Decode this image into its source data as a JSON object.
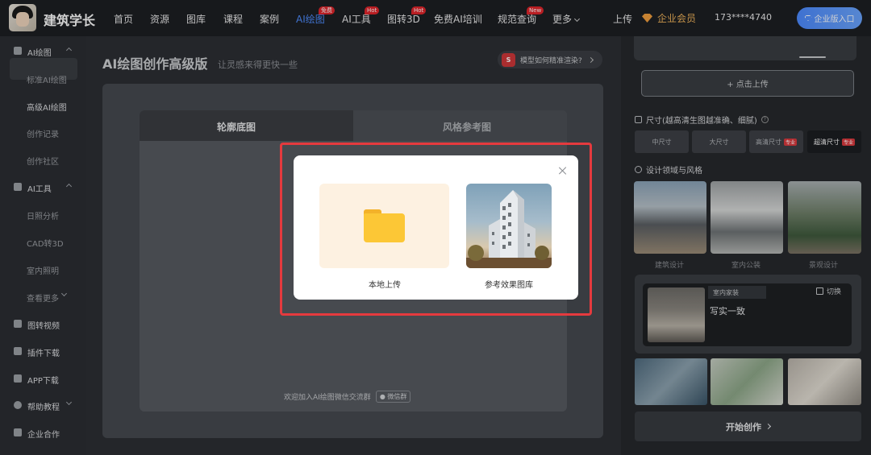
{
  "brand": {
    "name": "建筑学长"
  },
  "nav": {
    "items": [
      {
        "label": "首页"
      },
      {
        "label": "资源"
      },
      {
        "label": "图库"
      },
      {
        "label": "课程"
      },
      {
        "label": "案例"
      },
      {
        "label": "AI绘图",
        "badge": "免费",
        "active": true
      },
      {
        "label": "AI工具",
        "badge": "Hot"
      },
      {
        "label": "图转3D",
        "badge": "Hot"
      },
      {
        "label": "免费AI培训"
      },
      {
        "label": "规范查询",
        "badge": "New"
      },
      {
        "label": "更多"
      }
    ],
    "upload": "上传",
    "vip": "企业会员",
    "phone": "173****4740",
    "enterprise": "企业版入口",
    "accent_color": "#4f8dff"
  },
  "sidebar": {
    "items": [
      {
        "label": "AI绘图",
        "type": "group",
        "icon": "palette-icon"
      },
      {
        "label": "标准AI绘图",
        "type": "sub"
      },
      {
        "label": "高级AI绘图",
        "type": "sub",
        "active": true
      },
      {
        "label": "创作记录",
        "type": "sub"
      },
      {
        "label": "创作社区",
        "type": "sub"
      },
      {
        "label": "AI工具",
        "type": "group",
        "icon": "toolbox-icon"
      },
      {
        "label": "日照分析",
        "type": "sub"
      },
      {
        "label": "CAD转3D",
        "type": "sub"
      },
      {
        "label": "室内照明",
        "type": "sub"
      },
      {
        "label": "查看更多",
        "type": "sub"
      },
      {
        "label": "图转视频",
        "type": "group",
        "icon": "video-icon"
      },
      {
        "label": "插件下载",
        "type": "group",
        "icon": "puzzle-icon"
      },
      {
        "label": "APP下载",
        "type": "group",
        "icon": "download-icon"
      },
      {
        "label": "帮助教程",
        "type": "group",
        "icon": "help-icon"
      },
      {
        "label": "企业合作",
        "type": "group",
        "icon": "building-icon"
      }
    ]
  },
  "main": {
    "title": "AI绘图创作高级版",
    "subtitle": "让灵感来得更快一些",
    "hint": "模型如何精准渲染?",
    "tabs": [
      {
        "label": "轮廓底图"
      },
      {
        "label": "风格参考图"
      }
    ],
    "join_text": "欢迎加入AI绘图微信交流群",
    "join_tag": "微信群"
  },
  "modal": {
    "local_upload": "本地上传",
    "reference_gallery": "参考效果图库"
  },
  "right": {
    "upload_btn": "+ 点击上传",
    "size_title": "尺寸(越高清生图越准确、细腻)",
    "sizes": [
      {
        "label": "中尺寸"
      },
      {
        "label": "大尺寸"
      },
      {
        "label": "高清尺寸",
        "badge": "专业"
      },
      {
        "label": "超清尺寸",
        "badge": "专业",
        "selected": true
      }
    ],
    "domain_title": "设计领域与风格",
    "styles": [
      {
        "label": "建筑设计"
      },
      {
        "label": "室内公装"
      },
      {
        "label": "景观设计"
      }
    ],
    "interior": {
      "tag": "室内家装",
      "switch": "切换",
      "title": "写实一致"
    },
    "start": "开始创作"
  }
}
